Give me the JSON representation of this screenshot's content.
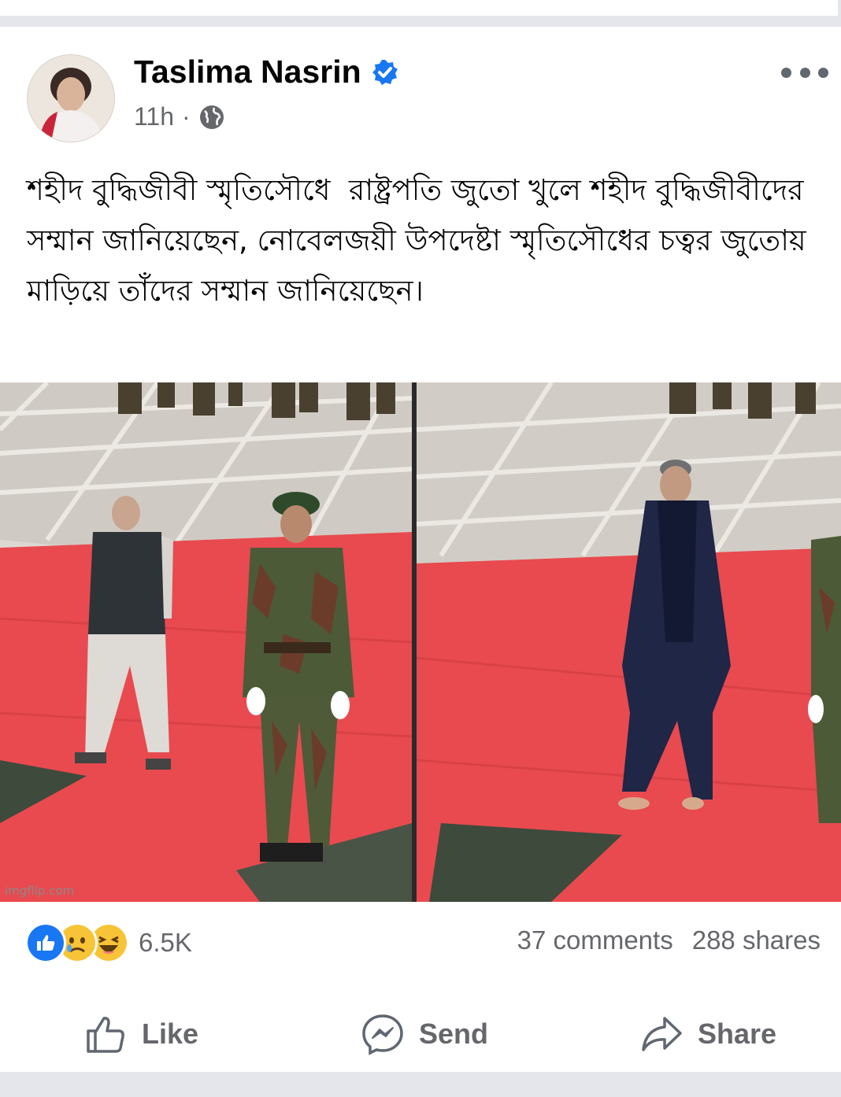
{
  "post": {
    "author": "Taslima Nasrin",
    "time": "11h",
    "separator": "·",
    "text": "শহীদ বুদ্ধিজীবী স্মৃতিসৌধে  রাষ্ট্রপতি জুতো খুলে শহীদ বুদ্ধিজীবীদের সম্মান জানিয়েছেন, নোবেলজয়ী উপদেষ্টা স্মৃতিসৌধের চত্বর জুতোয় মাড়িয়ে তাঁদের সম্মান জানিয়েছেন।",
    "image_watermark": "imgflip.com"
  },
  "engagement": {
    "reaction_icons": [
      "like-icon",
      "sad-icon",
      "haha-icon"
    ],
    "reaction_count": "6.5K",
    "comments": "37 comments",
    "shares": "288 shares"
  },
  "actions": {
    "like": "Like",
    "send": "Send",
    "share": "Share"
  },
  "colors": {
    "brand_blue": "#1877f2",
    "secondary_text": "#65676b",
    "divider": "#e4e6eb",
    "carpet_red": "#e84a4f"
  }
}
